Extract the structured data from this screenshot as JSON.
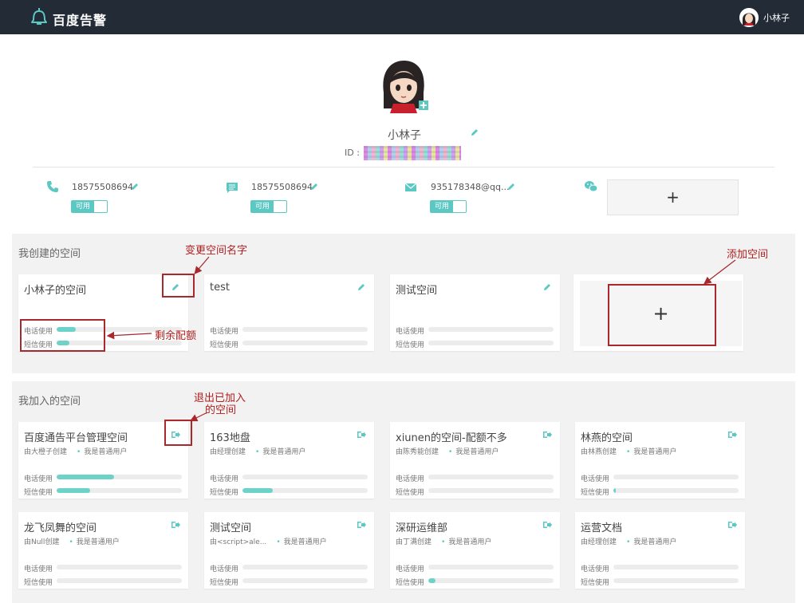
{
  "app": {
    "name": "百度告警"
  },
  "topbar": {
    "user_name": "小林子"
  },
  "profile": {
    "name": "小林子",
    "id_label": "ID :",
    "contacts": [
      {
        "icon": "phone-icon",
        "value": "18575508694",
        "toggle": "可用"
      },
      {
        "icon": "sms-icon",
        "value": "18575508694",
        "toggle": "可用"
      },
      {
        "icon": "mail-icon",
        "value": "935178348@qq...",
        "toggle": "可用"
      },
      {
        "icon": "wechat-icon",
        "add_label": "+"
      }
    ]
  },
  "created": {
    "title": "我创建的空间",
    "cards": [
      {
        "title": "小林子的空间",
        "phone_label": "电话使用",
        "sms_label": "短信使用",
        "phone_fill": 0.15,
        "sms_fill": 0.1
      },
      {
        "title": "test",
        "phone_label": "电话使用",
        "sms_label": "短信使用",
        "phone_fill": 0,
        "sms_fill": 0
      },
      {
        "title": "测试空间",
        "phone_label": "电话使用",
        "sms_label": "短信使用",
        "phone_fill": 0,
        "sms_fill": 0
      }
    ],
    "add_label": "+"
  },
  "joined": {
    "title": "我加入的空间",
    "cards": [
      {
        "title": "百度通告平台管理空间",
        "creator": "由大橙子创建",
        "role": "我是普通用户",
        "phone_label": "电话使用",
        "sms_label": "短信使用",
        "phone_fill": 0.46,
        "sms_fill": 0.27
      },
      {
        "title": "163地盘",
        "creator": "由经理创建",
        "role": "我是普通用户",
        "phone_label": "电话使用",
        "sms_label": "短信使用",
        "phone_fill": 0,
        "sms_fill": 0.24
      },
      {
        "title": "xiunen的空间-配额不多",
        "creator": "由陈秀能创建",
        "role": "我是普通用户",
        "phone_label": "电话使用",
        "sms_label": "短信使用",
        "phone_fill": 0,
        "sms_fill": 0
      },
      {
        "title": "林燕的空间",
        "creator": "由林燕创建",
        "role": "我是普通用户",
        "phone_label": "电话使用",
        "sms_label": "短信使用",
        "phone_fill": 0,
        "sms_fill": 0.02
      },
      {
        "title": "龙飞凤舞的空间",
        "creator": "由Null创建",
        "role": "我是普通用户",
        "phone_label": "电话使用",
        "sms_label": "短信使用",
        "phone_fill": 0,
        "sms_fill": 0
      },
      {
        "title": "测试空间",
        "creator": "由<script>ale...",
        "role": "我是普通用户",
        "phone_label": "电话使用",
        "sms_label": "短信使用",
        "phone_fill": 0,
        "sms_fill": 0
      },
      {
        "title": "深研运维部",
        "creator": "由丁满创建",
        "role": "我是普通用户",
        "phone_label": "电话使用",
        "sms_label": "短信使用",
        "phone_fill": 0,
        "sms_fill": 0.06
      },
      {
        "title": "运营文档",
        "creator": "由经理创建",
        "role": "我是普通用户",
        "phone_label": "电话使用",
        "sms_label": "短信使用",
        "phone_fill": 0,
        "sms_fill": 0
      }
    ]
  },
  "annotations": {
    "rename": "变更空间名字",
    "add_space": "添加空间",
    "quota": "剩余配额",
    "quit_line1": "退出已加入",
    "quit_line2": "的空间"
  },
  "colors": {
    "accent": "#5cc8c4",
    "bar": "#6dd3c8",
    "topbar": "#222b36",
    "annotation": "#a8282c"
  }
}
